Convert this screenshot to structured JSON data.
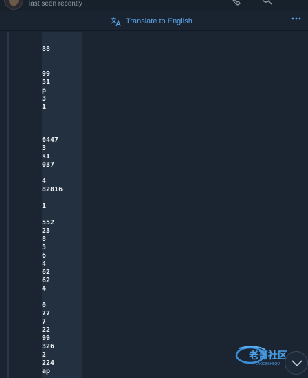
{
  "header": {
    "status_text": "last seen recently"
  },
  "translate": {
    "label": "Translate to English"
  },
  "message": {
    "lines": [
      {
        "text": "88"
      },
      {
        "text": "99"
      },
      {
        "text": "51"
      },
      {
        "text": "p"
      },
      {
        "text": "3"
      },
      {
        "text": "1"
      },
      {
        "text": "6447"
      },
      {
        "text": "3"
      },
      {
        "text": "s1"
      },
      {
        "text": "037"
      },
      {
        "text": "4"
      },
      {
        "text": "82816"
      },
      {
        "text": "1"
      },
      {
        "text": "552"
      },
      {
        "text": "23"
      },
      {
        "text": "8"
      },
      {
        "text": "5"
      },
      {
        "text": "6"
      },
      {
        "text": "4"
      },
      {
        "text": "62"
      },
      {
        "text": "62"
      },
      {
        "text": "4"
      },
      {
        "text": "0"
      },
      {
        "text": "77"
      },
      {
        "text": "7"
      },
      {
        "text": "22"
      },
      {
        "text": "99"
      },
      {
        "text": "326"
      },
      {
        "text": "2"
      },
      {
        "text": "224"
      },
      {
        "text": "ap"
      }
    ]
  },
  "colors": {
    "background": "#1b2532",
    "panel": "#22303f",
    "accent": "#5aa3e6",
    "text": "#eef1f5"
  },
  "icons": {
    "phone": "phone-icon",
    "search": "search-icon",
    "translate": "translate-icon",
    "more": "more-icon",
    "scroll": "chevron-down-icon"
  }
}
